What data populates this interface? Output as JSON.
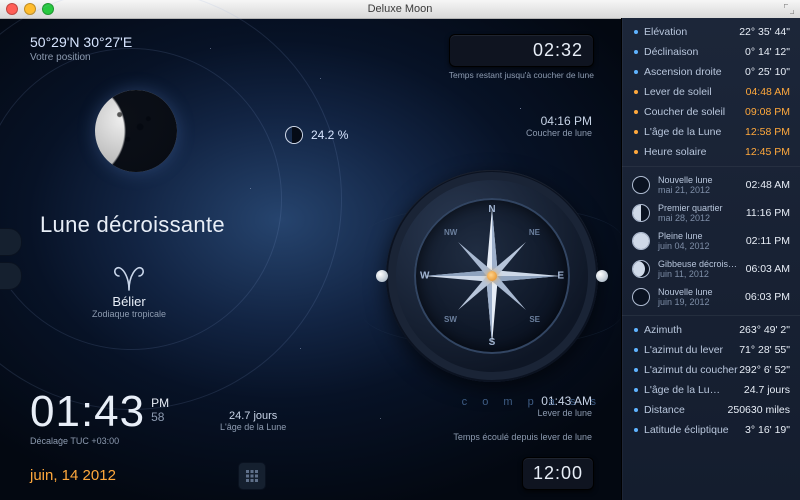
{
  "window": {
    "title": "Deluxe Moon"
  },
  "position": {
    "coords": "50°29'N 30°27'E",
    "caption": "Votre position"
  },
  "top_chip": {
    "value": "02:32",
    "caption": "Temps restant jusqu'à coucher de lune"
  },
  "bottom_chip": {
    "value": "12:00"
  },
  "illumination": {
    "value": "24.2 %"
  },
  "moonset_box": {
    "time": "04:16 PM",
    "caption": "Coucher de lune"
  },
  "moonrise_box": {
    "time": "01:43 AM",
    "caption": "Lever de lune",
    "sub": "Temps écoulé depuis lever de lune"
  },
  "phase_name": "Lune décroissante",
  "zodiac": {
    "name": "Bélier",
    "caption": "Zodiaque tropicale"
  },
  "clock": {
    "hhmm": "01:43",
    "ampm": "PM",
    "sec": "58",
    "caption": "Décalage TUC +03:00"
  },
  "moon_age_center": {
    "value": "24.7 jours",
    "caption": "L'âge de la Lune"
  },
  "date": "juin, 14 2012",
  "compass": {
    "N": "N",
    "S": "S",
    "E": "E",
    "W": "W",
    "NE": "NE",
    "NW": "NW",
    "SE": "SE",
    "SW": "SW",
    "label": "c  o  m  p  a  s  s"
  },
  "panel": {
    "astro": [
      {
        "label": "Elévation",
        "value": "22° 35' 44\"",
        "accent": false
      },
      {
        "label": "Déclinaison",
        "value": "0° 14' 12\"",
        "accent": false
      },
      {
        "label": "Ascension droite",
        "value": "0° 25' 10\"",
        "accent": false
      },
      {
        "label": "Lever de soleil",
        "value": "04:48 AM",
        "accent": true
      },
      {
        "label": "Coucher de soleil",
        "value": "09:08 PM",
        "accent": true
      },
      {
        "label": "L'âge de la Lune",
        "value": "12:58 PM",
        "accent": true
      },
      {
        "label": "Heure solaire",
        "value": "12:45 PM",
        "accent": true
      }
    ],
    "phases": [
      {
        "icon": "new",
        "name": "Nouvelle lune",
        "date": "mai 21, 2012",
        "time": "02:48 AM"
      },
      {
        "icon": "half",
        "name": "Premier quartier",
        "date": "mai 28, 2012",
        "time": "11:16 PM"
      },
      {
        "icon": "full",
        "name": "Pleine lune",
        "date": "juin 04, 2012",
        "time": "02:11 PM"
      },
      {
        "icon": "gib",
        "name": "Gibbeuse décroissante",
        "date": "juin 11, 2012",
        "time": "06:03 AM"
      },
      {
        "icon": "new",
        "name": "Nouvelle lune",
        "date": "juin 19, 2012",
        "time": "06:03 PM"
      }
    ],
    "extra": [
      {
        "label": "Azimuth",
        "value": "263° 49' 2\""
      },
      {
        "label": "L'azimut du lever",
        "value": "71° 28' 55\""
      },
      {
        "label": "L'azimut du coucher",
        "value": "292° 6' 52\""
      },
      {
        "label": "L'âge de la Lu…",
        "value": "24.7 jours"
      },
      {
        "label": "Distance",
        "value": "250630 miles"
      },
      {
        "label": "Latitude écliptique",
        "value": "3° 16' 19\""
      }
    ]
  }
}
